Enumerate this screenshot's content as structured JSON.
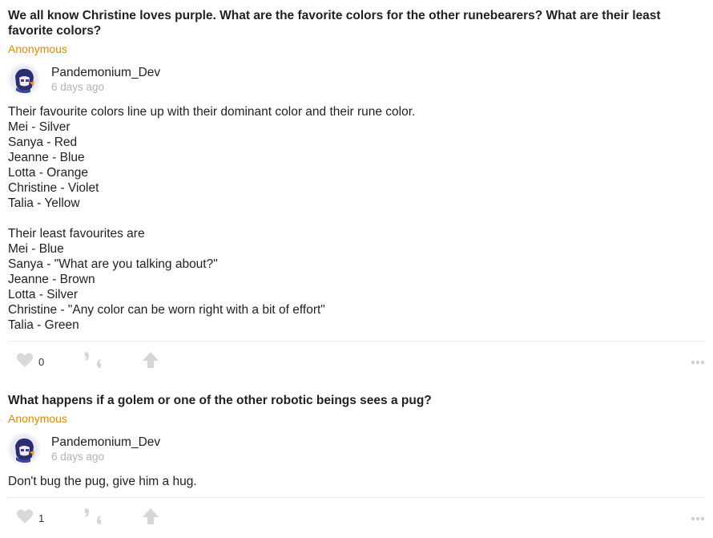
{
  "posts": [
    {
      "question": "We all know Christine loves purple. What are the favorite colors for the other runebearers? What are their least favorite colors?",
      "asker": "Anonymous",
      "author": "Pandemonium_Dev",
      "time": "6 days ago",
      "answer": "Their favourite colors line up with their dominant color and their rune color.\nMei - Silver\nSanya - Red\nJeanne - Blue\nLotta - Orange\nChristine - Violet\nTalia - Yellow\n\nTheir least favourites are\nMei - Blue\nSanya - \"What are you talking about?\"\nJeanne - Brown\nLotta - Silver\nChristine - \"Any color can be worn right with a bit of effort\"\nTalia - Green",
      "likes": "0"
    },
    {
      "question": "What happens if a golem or one of the other robotic beings sees a pug?",
      "asker": "Anonymous",
      "author": "Pandemonium_Dev",
      "time": "6 days ago",
      "answer": "Don't bug the pug, give him a hug.",
      "likes": "1"
    }
  ],
  "icons": {
    "like": "heart-icon",
    "share": "quote-icon",
    "upvote": "arrow-up-icon",
    "more": "more-dots-icon"
  },
  "colors": {
    "asker": "#e08a00",
    "icon_gray": "#d6d6d6",
    "time_gray": "#b3b3b3"
  }
}
